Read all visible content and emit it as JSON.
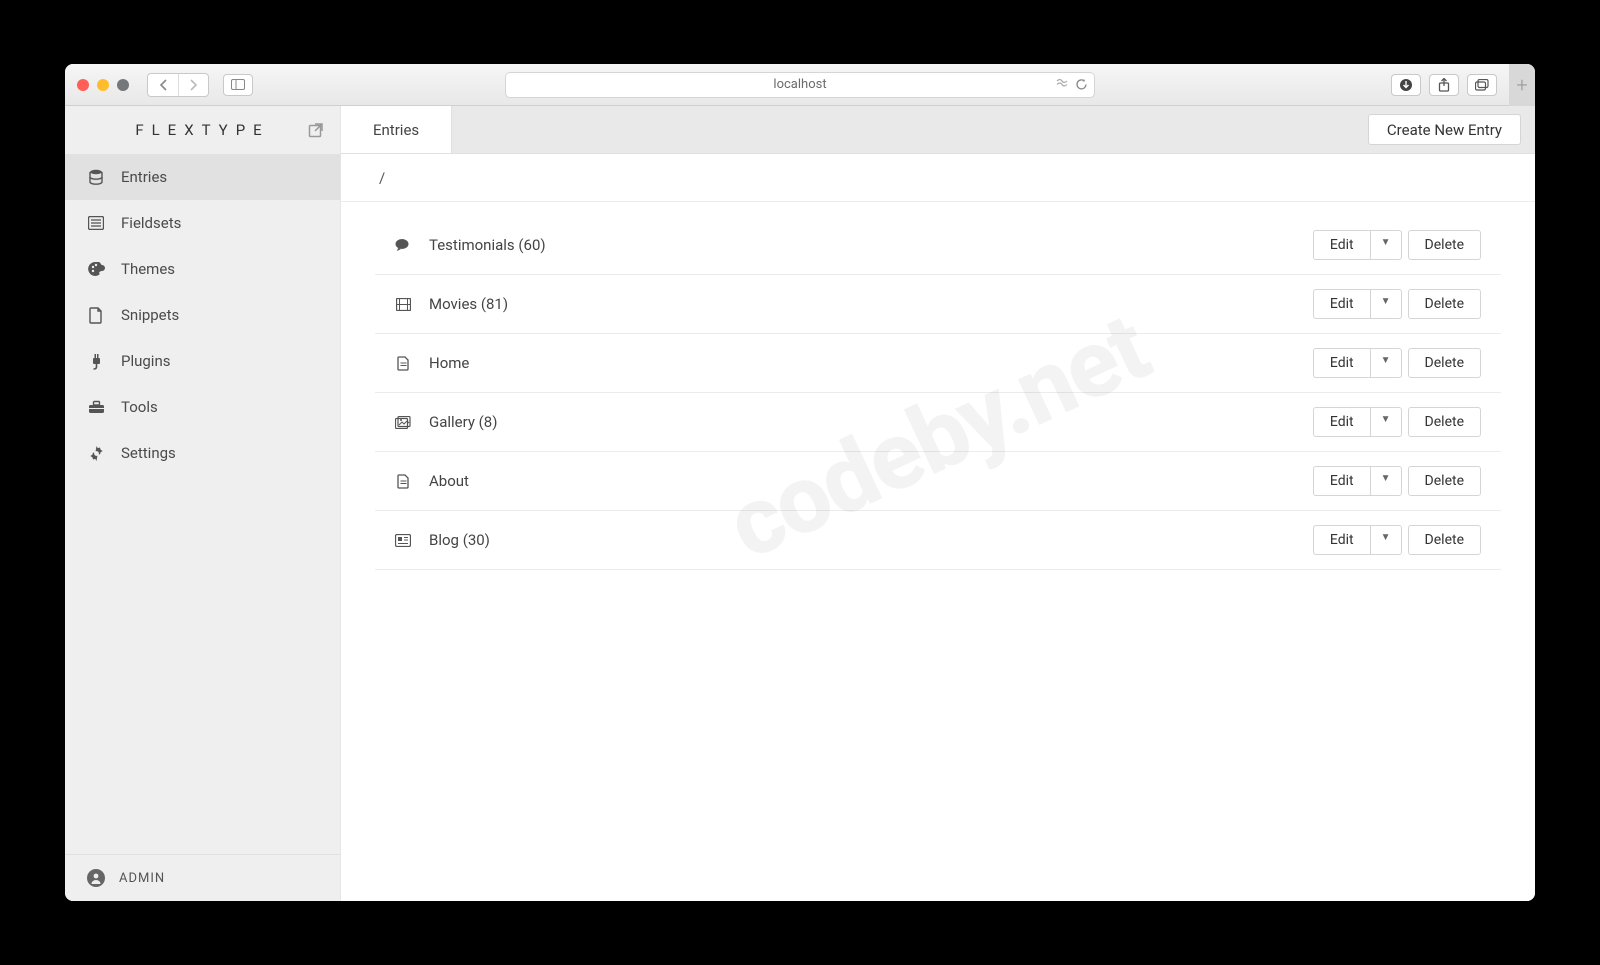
{
  "browser": {
    "url": "localhost"
  },
  "brand": {
    "name": "FLEXTYPE"
  },
  "sidebar": {
    "items": [
      {
        "label": "Entries",
        "icon": "database"
      },
      {
        "label": "Fieldsets",
        "icon": "list"
      },
      {
        "label": "Themes",
        "icon": "palette"
      },
      {
        "label": "Snippets",
        "icon": "file"
      },
      {
        "label": "Plugins",
        "icon": "plug"
      },
      {
        "label": "Tools",
        "icon": "toolbox"
      },
      {
        "label": "Settings",
        "icon": "gear"
      }
    ],
    "footer": {
      "user": "ADMIN"
    }
  },
  "topbar": {
    "tab": "Entries",
    "create_label": "Create New Entry"
  },
  "breadcrumb": "/",
  "entries": [
    {
      "label": "Testimonials (60)",
      "icon": "comments"
    },
    {
      "label": "Movies (81)",
      "icon": "film"
    },
    {
      "label": "Home",
      "icon": "file-text"
    },
    {
      "label": "Gallery (8)",
      "icon": "images"
    },
    {
      "label": "About",
      "icon": "file-text"
    },
    {
      "label": "Blog (30)",
      "icon": "newspaper"
    }
  ],
  "actions": {
    "edit": "Edit",
    "delete": "Delete"
  },
  "watermark": "codeby.net"
}
